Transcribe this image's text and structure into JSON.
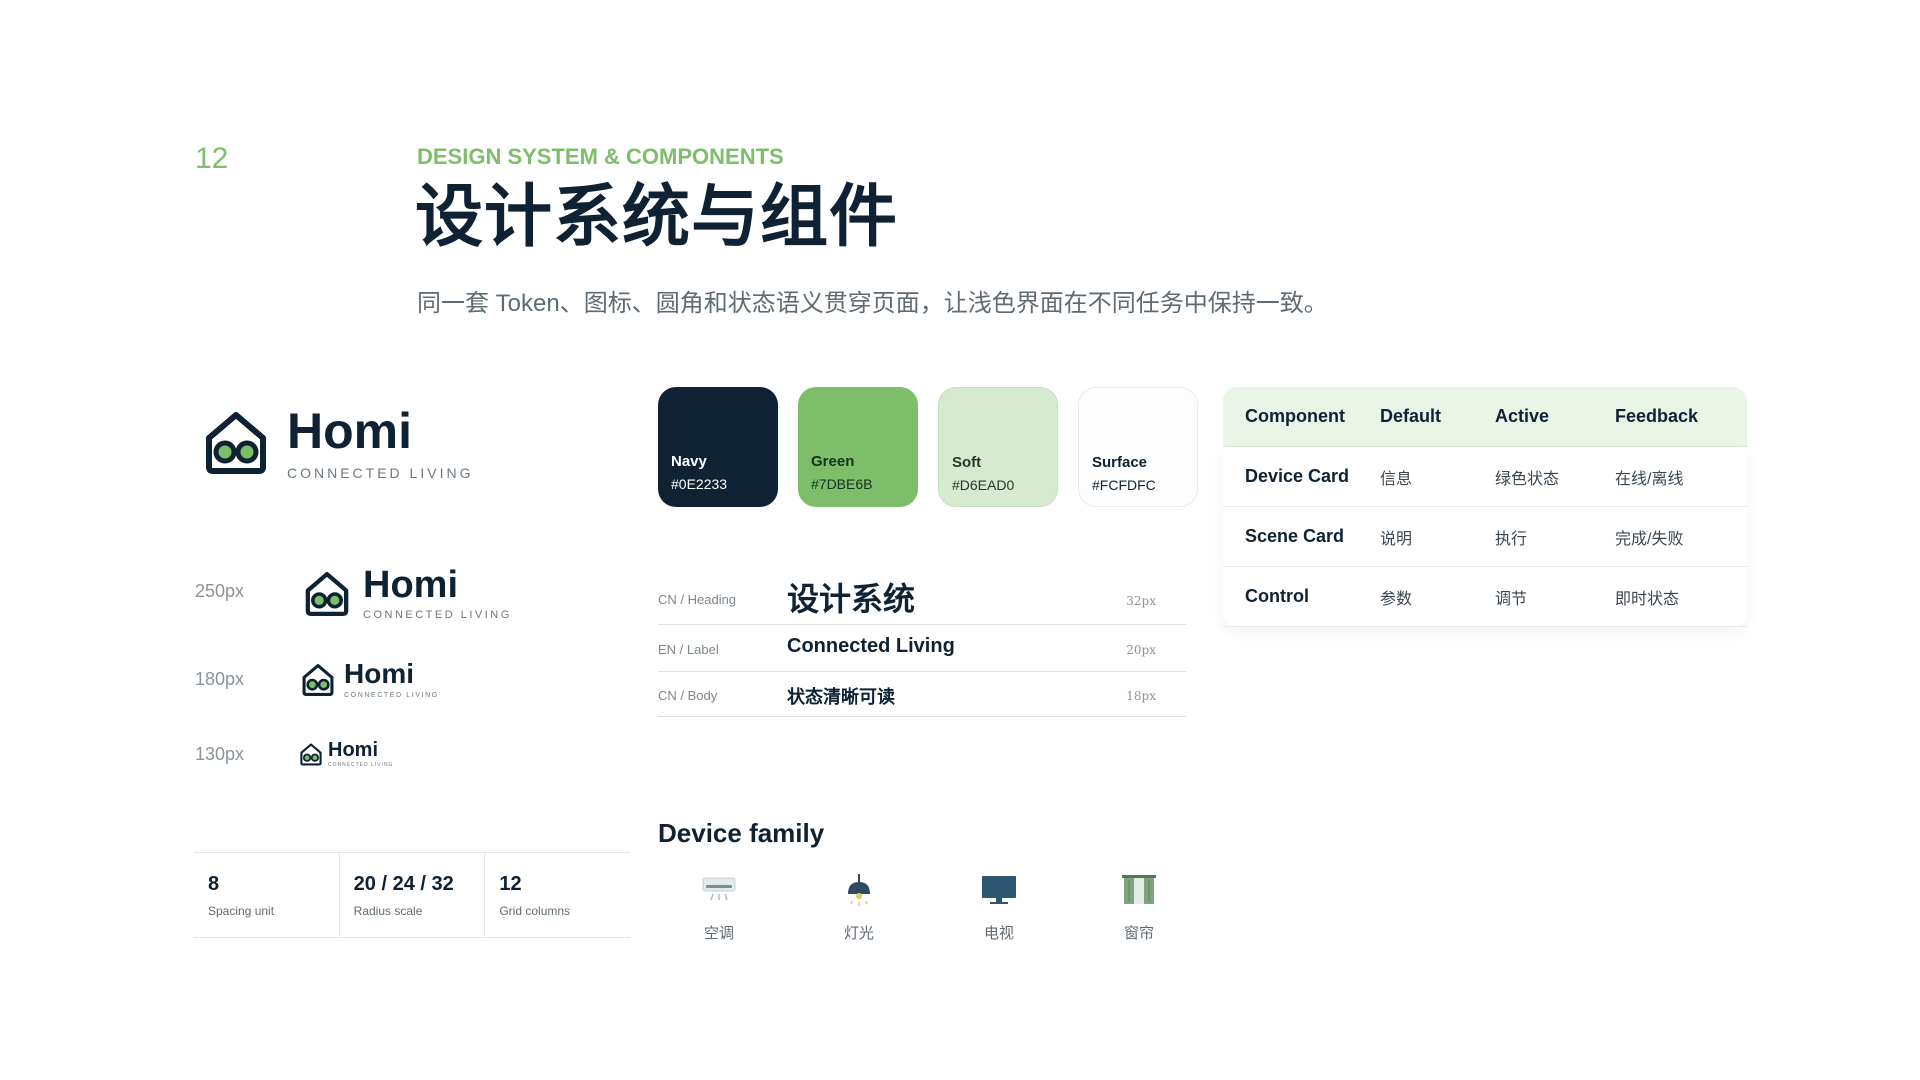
{
  "header": {
    "page_number": "12",
    "eyebrow": "DESIGN SYSTEM & COMPONENTS",
    "title": "设计系统与组件",
    "subtitle": "同一套 Token、图标、圆角和状态语义贯穿页面，让浅色界面在不同任务中保持一致。"
  },
  "logo": {
    "name": "Homi",
    "tagline": "CONNECTED LIVING",
    "icon": "house-with-glasses-icon"
  },
  "logo_sizes": [
    {
      "label": "250px"
    },
    {
      "label": "180px"
    },
    {
      "label": "130px"
    }
  ],
  "stats": [
    {
      "value": "8",
      "label": "Spacing unit"
    },
    {
      "value": "20 / 24 / 32",
      "label": "Radius scale"
    },
    {
      "value": "12",
      "label": "Grid columns"
    }
  ],
  "colors": [
    {
      "name": "Navy",
      "hex": "#0E2233"
    },
    {
      "name": "Green",
      "hex": "#7DBE6B"
    },
    {
      "name": "Soft",
      "hex": "#D6EAD0"
    },
    {
      "name": "Surface",
      "hex": "#FCFDFC"
    }
  ],
  "typography": [
    {
      "tag": "CN / Heading",
      "sample": "设计系统",
      "size": "32px"
    },
    {
      "tag": "EN / Label",
      "sample": "Connected Living",
      "size": "20px"
    },
    {
      "tag": "CN / Body",
      "sample": "状态清晰可读",
      "size": "18px"
    }
  ],
  "device_family": {
    "title": "Device family",
    "items": [
      {
        "label": "空调",
        "icon": "air-conditioner-icon"
      },
      {
        "label": "灯光",
        "icon": "pendant-lamp-icon"
      },
      {
        "label": "电视",
        "icon": "tv-icon"
      },
      {
        "label": "窗帘",
        "icon": "curtain-icon"
      }
    ]
  },
  "component_table": {
    "headers": [
      "Component",
      "Default",
      "Active",
      "Feedback"
    ],
    "rows": [
      [
        "Device Card",
        "信息",
        "绿色状态",
        "在线/离线"
      ],
      [
        "Scene Card",
        "说明",
        "执行",
        "完成/失败"
      ],
      [
        "Control",
        "参数",
        "调节",
        "即时状态"
      ]
    ]
  },
  "theme": {
    "navy": "#0E2233",
    "green": "#7DBE6B",
    "soft": "#D6EAD0",
    "surface": "#FCFDFC"
  }
}
